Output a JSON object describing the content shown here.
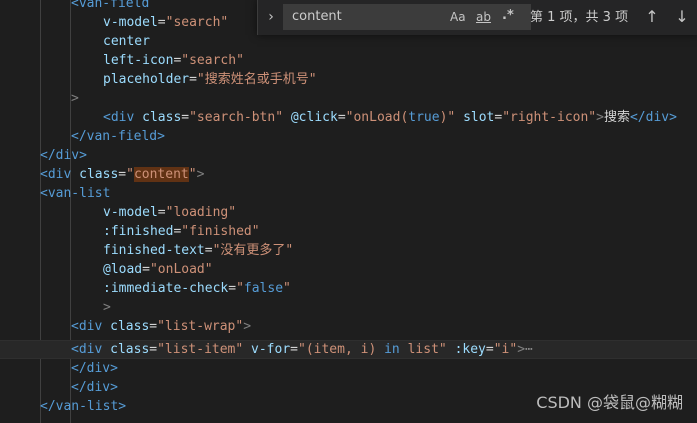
{
  "code": {
    "lines": [
      [
        "<van-field"
      ],
      [
        "v-model",
        "=",
        "\"search\""
      ],
      [
        "center"
      ],
      [
        "left-icon",
        "=",
        "\"search\""
      ],
      [
        "placeholder",
        "=",
        "\"搜索姓名或手机号\""
      ],
      [
        ">"
      ],
      [
        "<div",
        "class",
        "=",
        "\"search-btn\"",
        "@click",
        "=",
        "\"onLoad(",
        "true",
        ")\"",
        "slot",
        "=",
        "\"right-icon\"",
        ">",
        "搜索",
        "</div>"
      ],
      [
        "</van-field>"
      ],
      [
        "</div>"
      ],
      [
        "<div",
        "class",
        "=",
        "\"",
        "content",
        "\"",
        ">"
      ],
      [
        "<van-list"
      ],
      [
        "v-model",
        "=",
        "\"loading\""
      ],
      [
        ":finished",
        "=",
        "\"finished\""
      ],
      [
        "finished-text",
        "=",
        "\"没有更多了\""
      ],
      [
        "@load",
        "=",
        "\"onLoad\""
      ],
      [
        ":immediate-check",
        "=",
        "\"",
        "false",
        "\""
      ],
      [
        ">"
      ],
      [
        "<div",
        "class",
        "=",
        "\"list-wrap\"",
        ">"
      ],
      [
        "<div",
        "class",
        "=",
        "\"list-item\"",
        "v-for",
        "=",
        "\"(item, i)",
        "in",
        "list\"",
        ":key",
        "=",
        "\"i\"",
        ">",
        "⋯"
      ],
      [
        "</div>"
      ],
      [
        "</div>"
      ],
      [
        "</van-list>"
      ]
    ]
  },
  "find_widget": {
    "toggle_icon": "chevron-right-icon",
    "query": "content",
    "match_case": "Aa",
    "whole_word": "ab",
    "regex": ".*",
    "result": "第 1 项，共 3 项",
    "prev_icon": "arrow-up-icon",
    "next_icon": "arrow-down-icon"
  },
  "watermark": "CSDN @袋鼠@糊糊",
  "colors": {
    "background": "#1e1e1e",
    "tag": "#569cd6",
    "attribute": "#9cdcfe",
    "string": "#ce9178",
    "search_highlight": "#613214"
  }
}
